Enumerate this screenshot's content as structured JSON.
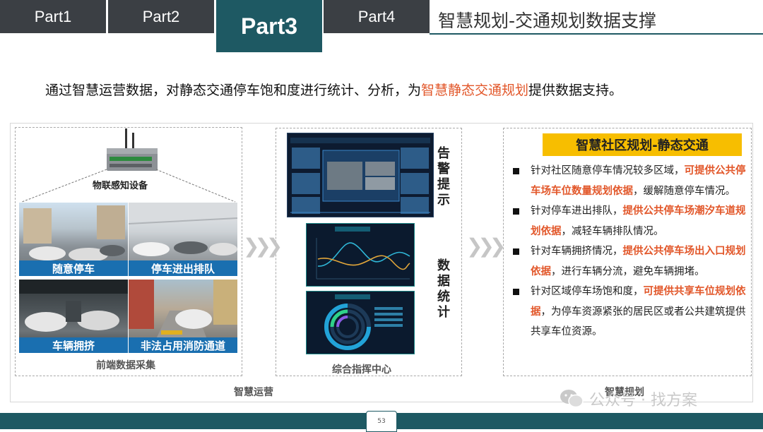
{
  "tabs": {
    "items": [
      {
        "label": "Part1"
      },
      {
        "label": "Part2"
      },
      {
        "label": "Part3",
        "active": true
      },
      {
        "label": "Part4"
      }
    ],
    "title": "智慧规划-交通规划数据支撑"
  },
  "intro": {
    "pre": "通过智慧运营数据，对静态交通停车饱和度进行统计、分析，为",
    "highlight": "智慧静态交通规划",
    "post": "提供数据支持。"
  },
  "left_panel": {
    "device_caption": "物联感知设备",
    "photos": [
      {
        "caption": "随意停车"
      },
      {
        "caption": "停车进出排队"
      },
      {
        "caption": "车辆拥挤"
      },
      {
        "caption": "非法占用消防通道"
      }
    ],
    "footer_label": "前端数据采集",
    "group_label": "智慧运营"
  },
  "center_panel": {
    "alert_label": "告警提示",
    "stats_label": "数据统计",
    "footer_label": "综合指挥中心"
  },
  "right_panel": {
    "banner": "智慧社区规划-静态交通",
    "bullets": [
      {
        "pre": "针对社区随意停车情况较多区域，",
        "highlight": "可提供公共停车场车位数量规划依据",
        "post": "，缓解随意停车情况。"
      },
      {
        "pre": "针对停车进出排队，",
        "highlight": "提供公共停车场潮汐车道规划依据",
        "post": "，减轻车辆排队情况。"
      },
      {
        "pre": "针对车辆拥挤情况，",
        "highlight": "提供公共停车场出入口规划依据",
        "post": "，进行车辆分流，避免车辆拥堵。"
      },
      {
        "pre": "针对区域停车场饱和度，",
        "highlight": "可提供共享车位规划依据",
        "post": "，为停车资源紧张的居民区或者公共建筑提供共享车位资源。"
      }
    ],
    "group_label": "智慧规划"
  },
  "watermark": "公众号 · 找方案",
  "page_number": "53",
  "colors": {
    "accent": "#1e5963",
    "highlight": "#e2572a",
    "banner": "#f7be00",
    "caption_bar": "#1a6fb0"
  }
}
